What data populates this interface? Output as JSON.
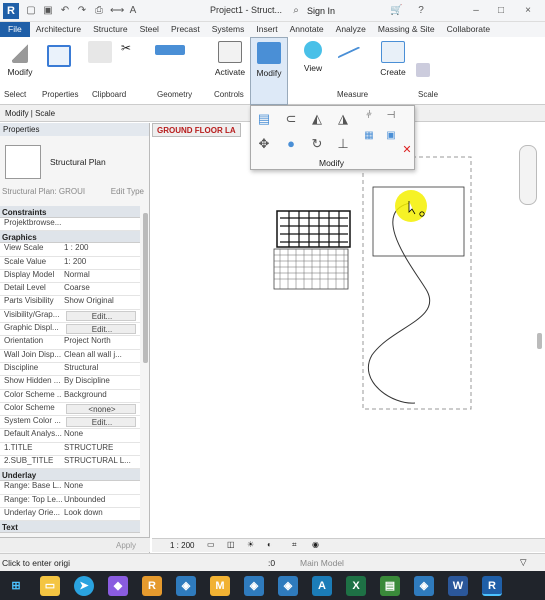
{
  "app": {
    "logo": "R",
    "title": "Project1 - Struct...",
    "signin": "Sign In"
  },
  "tabs": [
    "File",
    "Architecture",
    "Structure",
    "Steel",
    "Precast",
    "Systems",
    "Insert",
    "Annotate",
    "Analyze",
    "Massing & Site",
    "Collaborate"
  ],
  "ribbon": {
    "modify": "Modify",
    "activate": "Activate",
    "modify2": "Modify",
    "view": "View",
    "create": "Create",
    "groups": {
      "select": "Select",
      "properties": "Properties",
      "clipboard": "Clipboard",
      "geometry": "Geometry",
      "controls": "Controls",
      "measure": "Measure",
      "scale": "Scale"
    }
  },
  "context_bar": "Modify | Scale",
  "modify_panel": {
    "label": "Modify"
  },
  "properties": {
    "header": "Properties",
    "type_name": "Structural Plan",
    "type_selector": "Structural Plan: GROUI",
    "edit_type": "Edit Type",
    "sections": [
      {
        "name": "Constraints",
        "rows": [
          {
            "k": "Projektbrowse...",
            "v": ""
          }
        ]
      },
      {
        "name": "Graphics",
        "rows": [
          {
            "k": "View Scale",
            "v": "1 : 200"
          },
          {
            "k": "Scale Value",
            "v": "1:  200"
          },
          {
            "k": "Display Model",
            "v": "Normal"
          },
          {
            "k": "Detail Level",
            "v": "Coarse"
          },
          {
            "k": "Parts Visibility",
            "v": "Show Original"
          },
          {
            "k": "Visibility/Grap...",
            "v": "Edit..."
          },
          {
            "k": "Graphic Displ...",
            "v": "Edit..."
          },
          {
            "k": "Orientation",
            "v": "Project North"
          },
          {
            "k": "Wall Join Disp...",
            "v": "Clean all wall j..."
          },
          {
            "k": "Discipline",
            "v": "Structural"
          },
          {
            "k": "Show Hidden ...",
            "v": "By Discipline"
          },
          {
            "k": "Color Scheme ...",
            "v": "Background"
          },
          {
            "k": "Color Scheme",
            "v": "<none>"
          },
          {
            "k": "System Color ...",
            "v": "Edit..."
          },
          {
            "k": "Default Analys...",
            "v": "None"
          },
          {
            "k": "1.TITLE",
            "v": "STRUCTURE"
          },
          {
            "k": "2.SUB_TITLE",
            "v": "STRUCTURAL L..."
          }
        ]
      },
      {
        "name": "Underlay",
        "rows": [
          {
            "k": "Range: Base L...",
            "v": "None"
          },
          {
            "k": "Range: Top Le...",
            "v": "Unbounded"
          },
          {
            "k": "Underlay Orie...",
            "v": "Look down"
          }
        ]
      },
      {
        "name": "Text",
        "rows": []
      }
    ],
    "apply": "Apply"
  },
  "view_tab": "GROUND FLOOR LA",
  "view_scale": "1 : 200",
  "status": {
    "message": "Click to enter origi",
    "zero": ":0",
    "model": "Main Model"
  }
}
